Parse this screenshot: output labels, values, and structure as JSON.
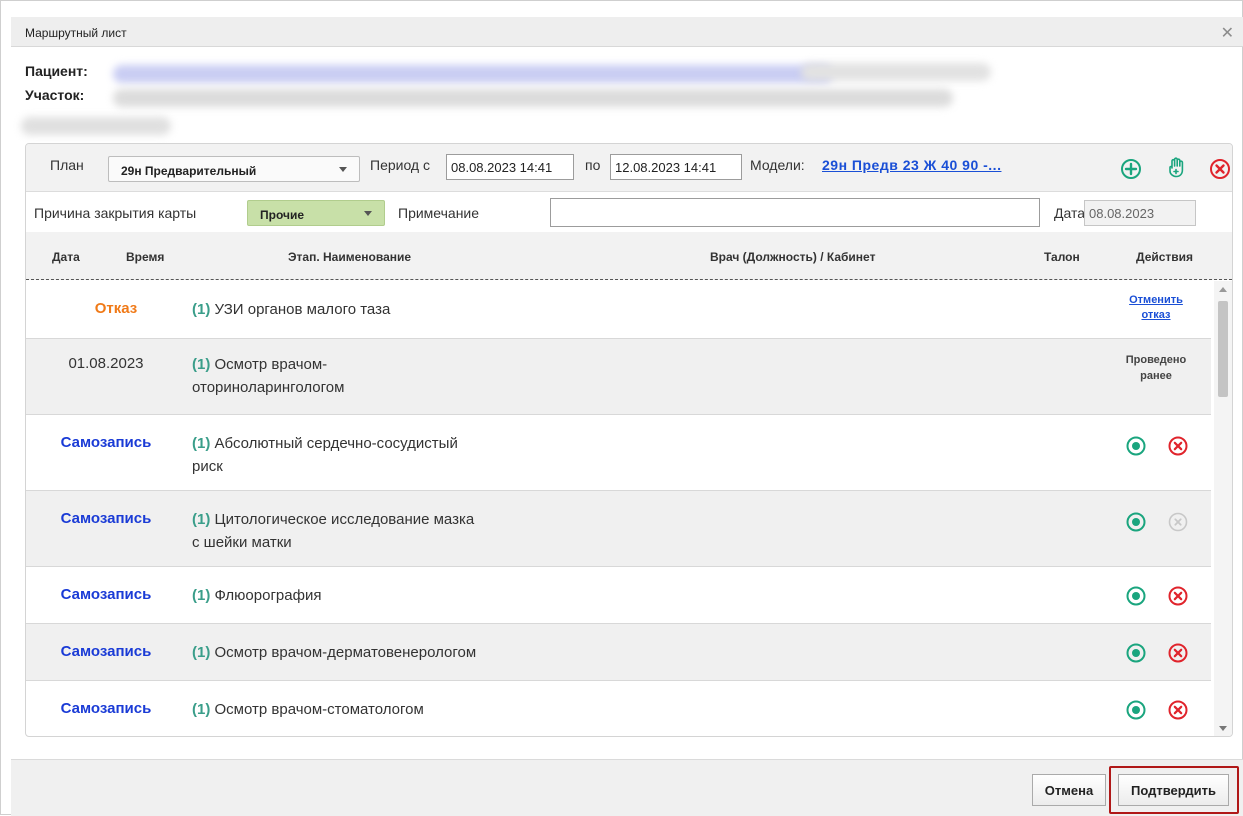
{
  "window": {
    "title": "Маршрутный лист"
  },
  "patient": {
    "patient_label": "Пациент:",
    "district_label": "Участок:"
  },
  "toolbar": {
    "plan_label": "План",
    "plan_value": "29н Предварительный",
    "period_from_label": "Период с",
    "period_from": "08.08.2023 14:41",
    "period_to_label": "по",
    "period_to": "12.08.2023 14:41",
    "models_label": "Модели:",
    "models_link": "29н Предв 23 Ж 40 90 -..."
  },
  "closure": {
    "reason_label": "Причина закрытия карты",
    "reason_value": "Прочие",
    "note_label": "Примечание",
    "note_value": "",
    "date_label": "Дата",
    "date_value": "08.08.2023"
  },
  "table": {
    "headers": {
      "date": "Дата",
      "time": "Время",
      "stage": "Этап. Наименование",
      "doctor": "Врач (Должность) / Кабинет",
      "ticket": "Талон",
      "actions": "Действия"
    },
    "rows": [
      {
        "status": "Отказ",
        "num": "(1)",
        "line1": "УЗИ органов малого таза",
        "line2": "",
        "action_link_1": "Отменить",
        "action_link_2": "отказ"
      },
      {
        "status": "01.08.2023",
        "num": "(1)",
        "line1": "Осмотр врачом-",
        "line2": "оториноларингологом",
        "action_text_1": "Проведено",
        "action_text_2": "ранее"
      },
      {
        "status": "Самозапись",
        "num": "(1)",
        "line1": "Абсолютный сердечно-сосудистый",
        "line2": "риск",
        "cancel_enabled": true
      },
      {
        "status": "Самозапись",
        "num": "(1)",
        "line1": "Цитологическое исследование мазка",
        "line2": "с шейки матки",
        "cancel_enabled": false
      },
      {
        "status": "Самозапись",
        "num": "(1)",
        "line1": "Флюорография",
        "line2": "",
        "cancel_enabled": true
      },
      {
        "status": "Самозапись",
        "num": "(1)",
        "line1": "Осмотр врачом-дерматовенерологом",
        "line2": "",
        "cancel_enabled": true
      },
      {
        "status": "Самозапись",
        "num": "(1)",
        "line1": "Осмотр врачом-стоматологом",
        "line2": "",
        "cancel_enabled": true
      }
    ]
  },
  "footer": {
    "cancel_label": "Отмена",
    "confirm_label": "Подтвердить"
  },
  "colors": {
    "refusal": "#f07a18",
    "self_booking": "#1a3bd6",
    "stage_number": "#3a9e8a",
    "link": "#1a4fd6",
    "select_action": "#1aa57e",
    "cancel_action": "#e0242c",
    "highlight": "#b01818"
  },
  "icons": {
    "add": "add-circle-icon",
    "hand": "hand-plus-icon",
    "cancel": "cancel-circle-icon",
    "select": "radio-dot-icon",
    "close": "close-icon"
  }
}
